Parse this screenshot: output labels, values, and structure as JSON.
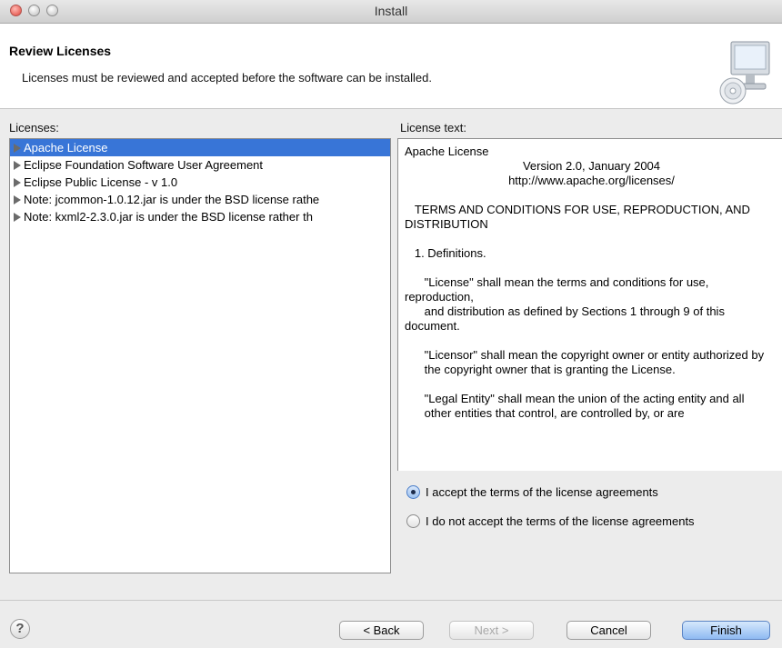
{
  "window": {
    "title": "Install"
  },
  "banner": {
    "title": "Review Licenses",
    "description": "Licenses must be reviewed and accepted before the software can be installed."
  },
  "licenses": {
    "label": "Licenses:",
    "items": [
      {
        "label": "Apache License",
        "selected": true
      },
      {
        "label": "Eclipse Foundation Software User Agreement",
        "selected": false
      },
      {
        "label": "Eclipse Public License - v 1.0",
        "selected": false
      },
      {
        "label": "Note:  jcommon-1.0.12.jar is under the BSD license rathe",
        "selected": false
      },
      {
        "label": "Note:  kxml2-2.3.0.jar is under the BSD license rather th",
        "selected": false
      }
    ]
  },
  "license_text": {
    "label": "License text:",
    "lines": [
      "Apache License",
      "Version 2.0, January 2004",
      "http://www.apache.org/licenses/",
      "",
      "   TERMS AND CONDITIONS FOR USE, REPRODUCTION, AND DISTRIBUTION",
      "",
      "   1. Definitions.",
      "",
      "      \"License\" shall mean the terms and conditions for use, reproduction,",
      "      and distribution as defined by Sections 1 through 9 of this document.",
      "",
      "      \"Licensor\" shall mean the copyright owner or entity authorized by",
      "      the copyright owner that is granting the License.",
      "",
      "      \"Legal Entity\" shall mean the union of the acting entity and all",
      "      other entities that control, are controlled by, or are"
    ]
  },
  "options": {
    "accept": "I accept the terms of the license agreements",
    "decline": "I do not accept the terms of the license agreements",
    "selected": "accept"
  },
  "buttons": {
    "help": "?",
    "back": "< Back",
    "next": "Next >",
    "cancel": "Cancel",
    "finish": "Finish"
  },
  "icons": {
    "help": "help-icon",
    "install": "install-computer-icon",
    "disclosure": "disclosure-triangle-icon"
  }
}
